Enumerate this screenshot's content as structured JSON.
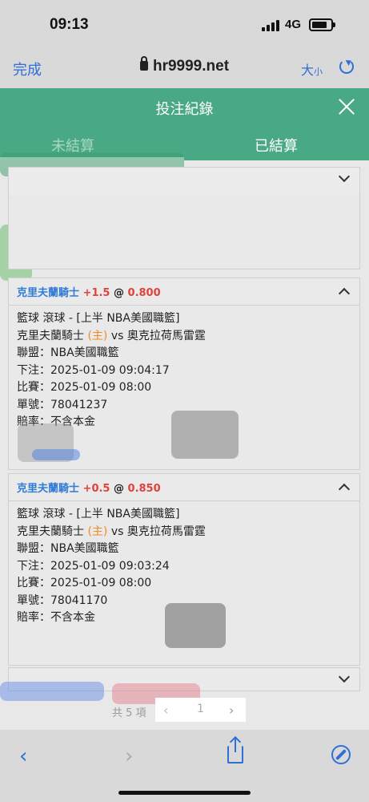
{
  "status_bar": {
    "time": "09:13",
    "network": "4G"
  },
  "browser": {
    "done_label": "完成",
    "url": "hr9999.net",
    "font_size_label": "大",
    "font_size_small": "小"
  },
  "header": {
    "title": "投注紀錄"
  },
  "tabs": [
    {
      "label": "未結算",
      "active": true
    },
    {
      "label": "已結算",
      "active": false
    }
  ],
  "bets": [
    {
      "team": "克里夫蘭騎士",
      "handicap": "+1.5",
      "at": "@",
      "odds": "0.800",
      "sport_line": "籃球 滾球 - [上半 NBA美國職籃]",
      "match_home": "克里夫蘭騎士",
      "home_tag": "(主)",
      "vs": "vs",
      "match_away": "奧克拉荷馬雷霆",
      "league": "聯盟：NBA美國職籃",
      "bet_time": "下注：2025-01-09 09:04:17",
      "match_time": "比賽：2025-01-09 08:00",
      "ticket": "單號：78041237",
      "odds_type": "賠率：不含本金"
    },
    {
      "team": "克里夫蘭騎士",
      "handicap": "+0.5",
      "at": "@",
      "odds": "0.850",
      "sport_line": "籃球 滾球 - [上半 NBA美國職籃]",
      "match_home": "克里夫蘭騎士",
      "home_tag": "(主)",
      "vs": "vs",
      "match_away": "奧克拉荷馬雷霆",
      "league": "聯盟：NBA美國職籃",
      "bet_time": "下注：2025-01-09 09:03:24",
      "match_time": "比賽：2025-01-09 08:00",
      "ticket": "單號：78041170",
      "odds_type": "賠率：不含本金"
    }
  ],
  "pagination": {
    "total": "共 5 項",
    "page": "1",
    "prev": "‹",
    "next": "›"
  },
  "toolbar": {
    "back": "‹",
    "forward": "›"
  },
  "colors": {
    "header_green": "#4aa985",
    "team_blue": "#2f7bd6",
    "red": "#e0433c",
    "home_orange": "#f08a24",
    "browser_blue": "#2f6fd6"
  }
}
